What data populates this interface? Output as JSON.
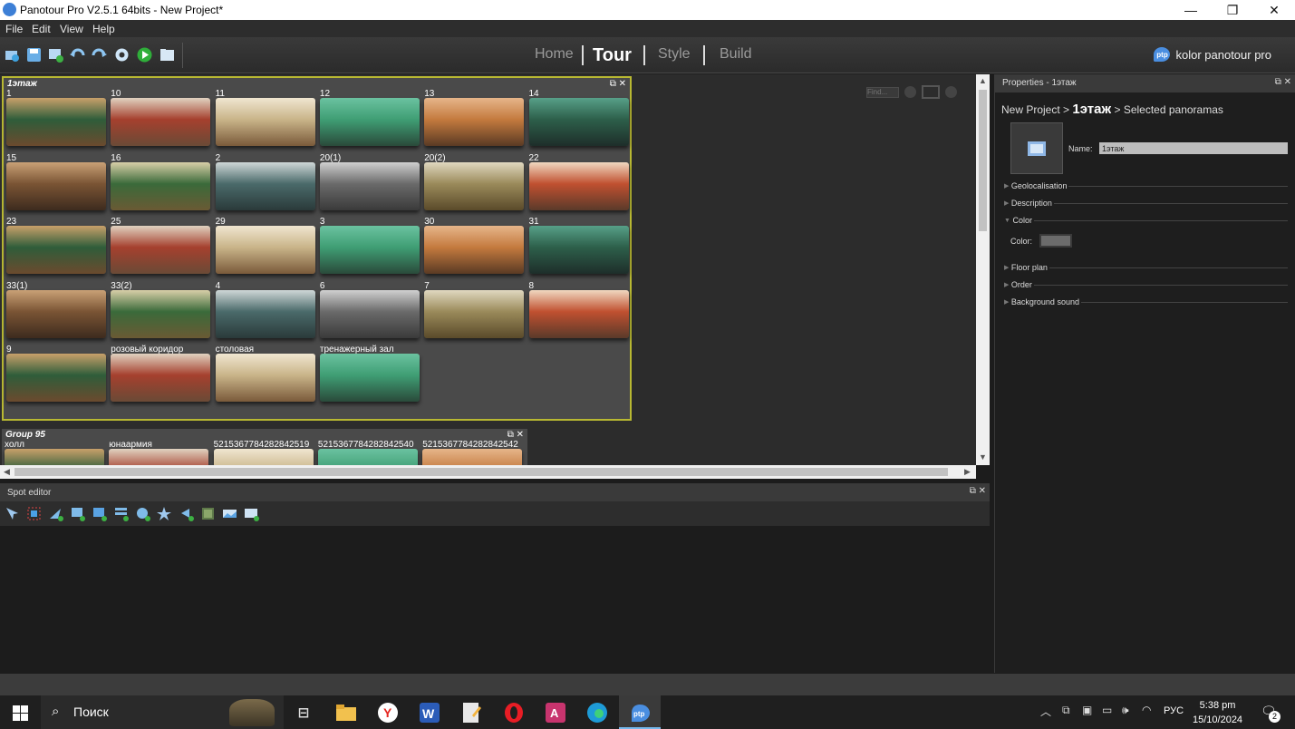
{
  "window": {
    "title": "Panotour Pro V2.5.1 64bits - New Project*",
    "minimize": "—",
    "maximize": "❐",
    "close": "✕"
  },
  "menu": [
    "File",
    "Edit",
    "View",
    "Help"
  ],
  "nav": {
    "home": "Home",
    "tour": "Tour",
    "style": "Style",
    "build": "Build"
  },
  "brand": {
    "logo": "ptp",
    "name": "kolor panotour pro"
  },
  "canvas_tools": {
    "find_placeholder": "Find..."
  },
  "group1": {
    "title": "1этаж",
    "panoramas": [
      "1",
      "10",
      "11",
      "12",
      "13",
      "14",
      "15",
      "16",
      "2",
      "20(1)",
      "20(2)",
      "22",
      "23",
      "25",
      "29",
      "3",
      "30",
      "31",
      "33(1)",
      "33(2)",
      "4",
      "6",
      "7",
      "8",
      "9",
      "розовый коридор",
      "столовая",
      "тренажерный зал"
    ]
  },
  "group2": {
    "title": "Group 95",
    "panoramas": [
      "холл",
      "юнаармия",
      "5215367784282842519",
      "5215367784282842540",
      "5215367784282842542"
    ]
  },
  "properties": {
    "header": "Properties - 1этаж",
    "crumb_root": "New Project",
    "crumb_group": "1этаж",
    "crumb_sel": "Selected panoramas",
    "name_label": "Name:",
    "name_value": "1этаж",
    "sections": {
      "geo": "Geolocalisation",
      "desc": "Description",
      "color": "Color",
      "floor": "Floor plan",
      "order": "Order",
      "sound": "Background sound"
    },
    "color_label": "Color:",
    "color_value": "#6b6b6b"
  },
  "spot_editor": {
    "title": "Spot editor"
  },
  "taskbar": {
    "search": "Поиск",
    "lang": "РУС",
    "time": "5:38 pm",
    "date": "15/10/2024",
    "notif": "2"
  },
  "colors": {
    "accent_selected": "#b8b832",
    "brand_blue": "#4a8ee0"
  }
}
